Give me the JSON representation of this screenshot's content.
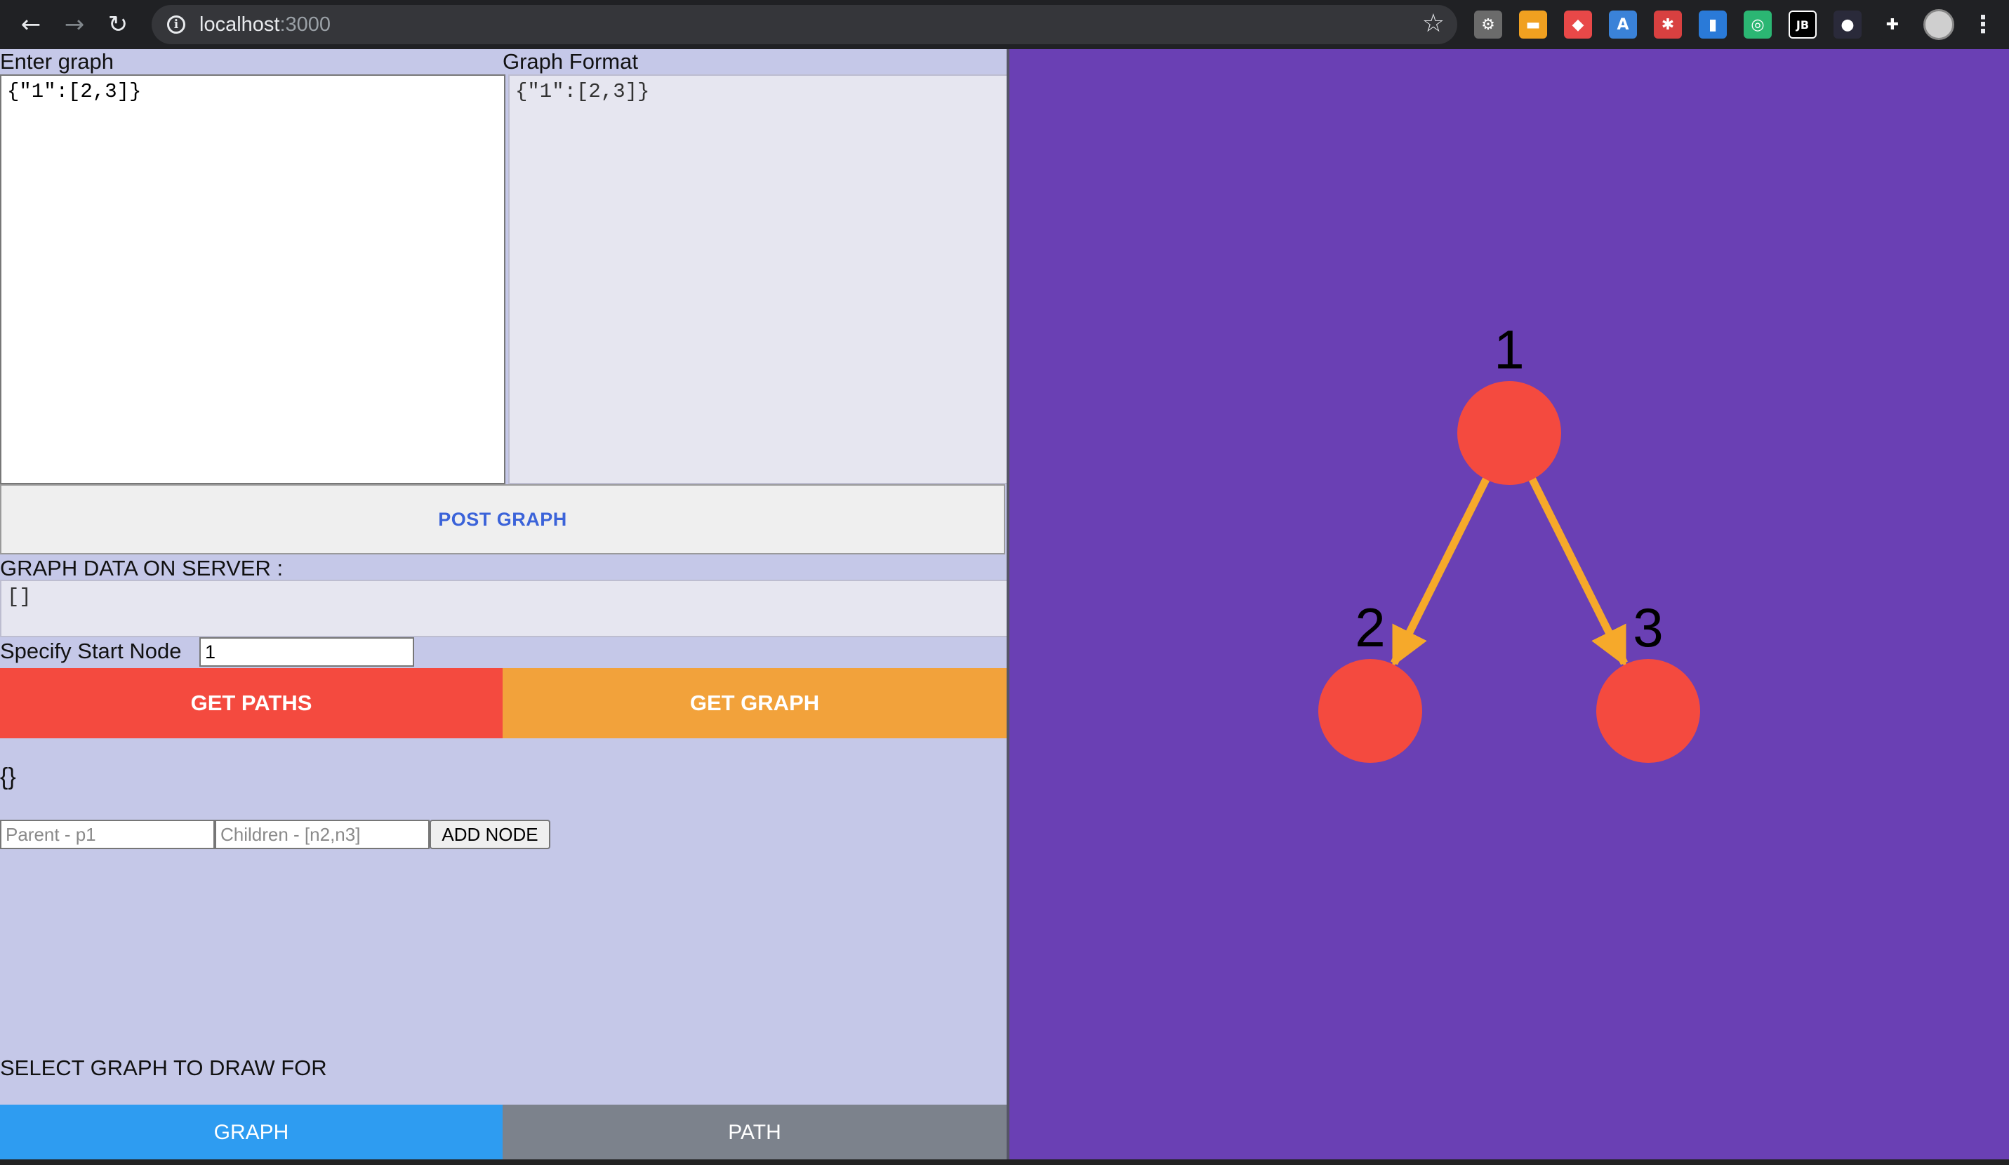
{
  "browser": {
    "url_host": "localhost",
    "url_port": ":3000",
    "nav": {
      "back": "←",
      "forward": "→",
      "reload": "↻"
    },
    "icons": {
      "info": "i",
      "bookmark": "☆",
      "menu": "⋮"
    },
    "extensions": [
      {
        "name": "gear-ext-icon",
        "color": "#6b6b6b",
        "glyph": "⚙"
      },
      {
        "name": "orange-ext-icon",
        "color": "#f0a020",
        "glyph": "▬"
      },
      {
        "name": "shield-ext-icon",
        "color": "#e84848",
        "glyph": "◆"
      },
      {
        "name": "translate-ext-icon",
        "color": "#3a82d8",
        "glyph": "A"
      },
      {
        "name": "bug-ext-icon",
        "color": "#d84040",
        "glyph": "✱"
      },
      {
        "name": "trello-ext-icon",
        "color": "#2a7ad8",
        "glyph": "▮"
      },
      {
        "name": "target-ext-icon",
        "color": "#2bb673",
        "glyph": "◎"
      },
      {
        "name": "jetbrains-ext-icon",
        "color": "#000000",
        "glyph": "JB"
      },
      {
        "name": "dark-ext-icon",
        "color": "#2a2a3a",
        "glyph": "●"
      },
      {
        "name": "puzzle-ext-icon",
        "color": "#202124",
        "glyph": "✚"
      }
    ]
  },
  "editor": {
    "enter_label": "Enter graph",
    "enter_value": "{\"1\":[2,3]}",
    "format_label": "Graph Format",
    "format_value": "{\"1\":[2,3]}",
    "post_button": "POST GRAPH"
  },
  "server": {
    "label": "GRAPH DATA ON SERVER :",
    "value": "[]"
  },
  "start": {
    "label": "Specify Start Node",
    "value": "1"
  },
  "actions": {
    "get_paths": "GET PATHS",
    "get_graph": "GET GRAPH"
  },
  "result": "{}",
  "add_node": {
    "parent_placeholder": "Parent - p1",
    "children_placeholder": "Children - [n2,n3]",
    "button": "ADD NODE"
  },
  "draw": {
    "label": "SELECT GRAPH TO DRAW FOR",
    "graph_button": "GRAPH",
    "path_button": "PATH"
  },
  "graph": {
    "background": "#6a40b4",
    "node_color": "#f44a3f",
    "edge_color": "#f6a92a",
    "nodes": [
      "1",
      "2",
      "3"
    ],
    "edges": [
      [
        "1",
        "2"
      ],
      [
        "1",
        "3"
      ]
    ]
  }
}
